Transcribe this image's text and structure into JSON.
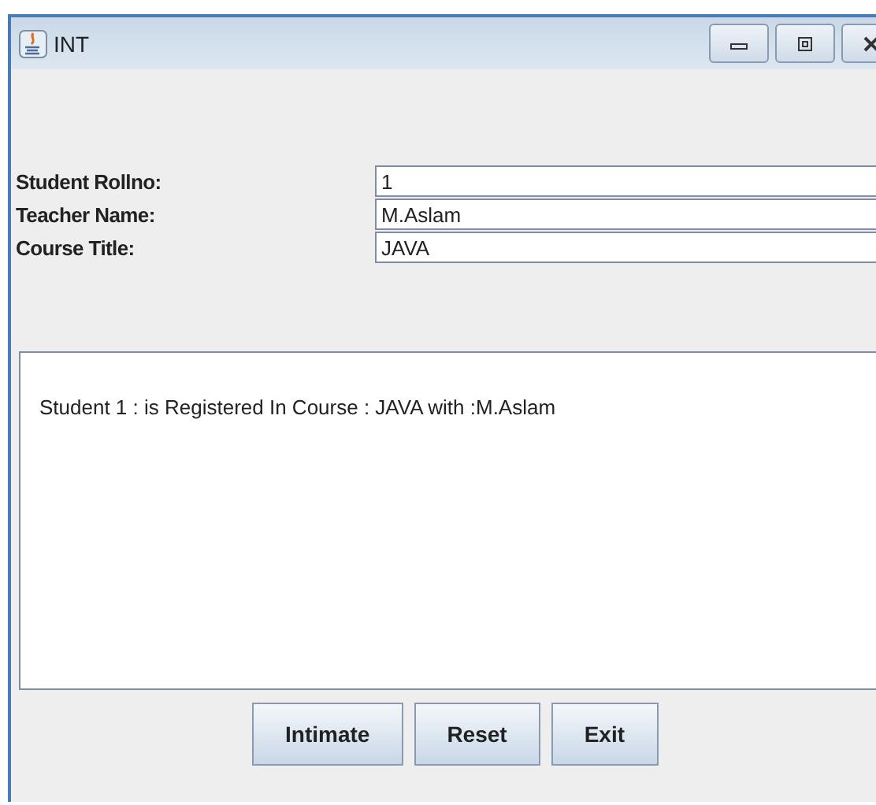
{
  "window": {
    "title": "INT"
  },
  "fields": [
    {
      "label": "Student Rollno:",
      "value": "1"
    },
    {
      "label": "Teacher Name:",
      "value": "M.Aslam"
    },
    {
      "label": "Course Title:",
      "value": "JAVA"
    }
  ],
  "output": "Student 1 : is Registered In Course : JAVA with :M.Aslam",
  "buttons": [
    "Intimate",
    "Reset",
    "Exit"
  ]
}
